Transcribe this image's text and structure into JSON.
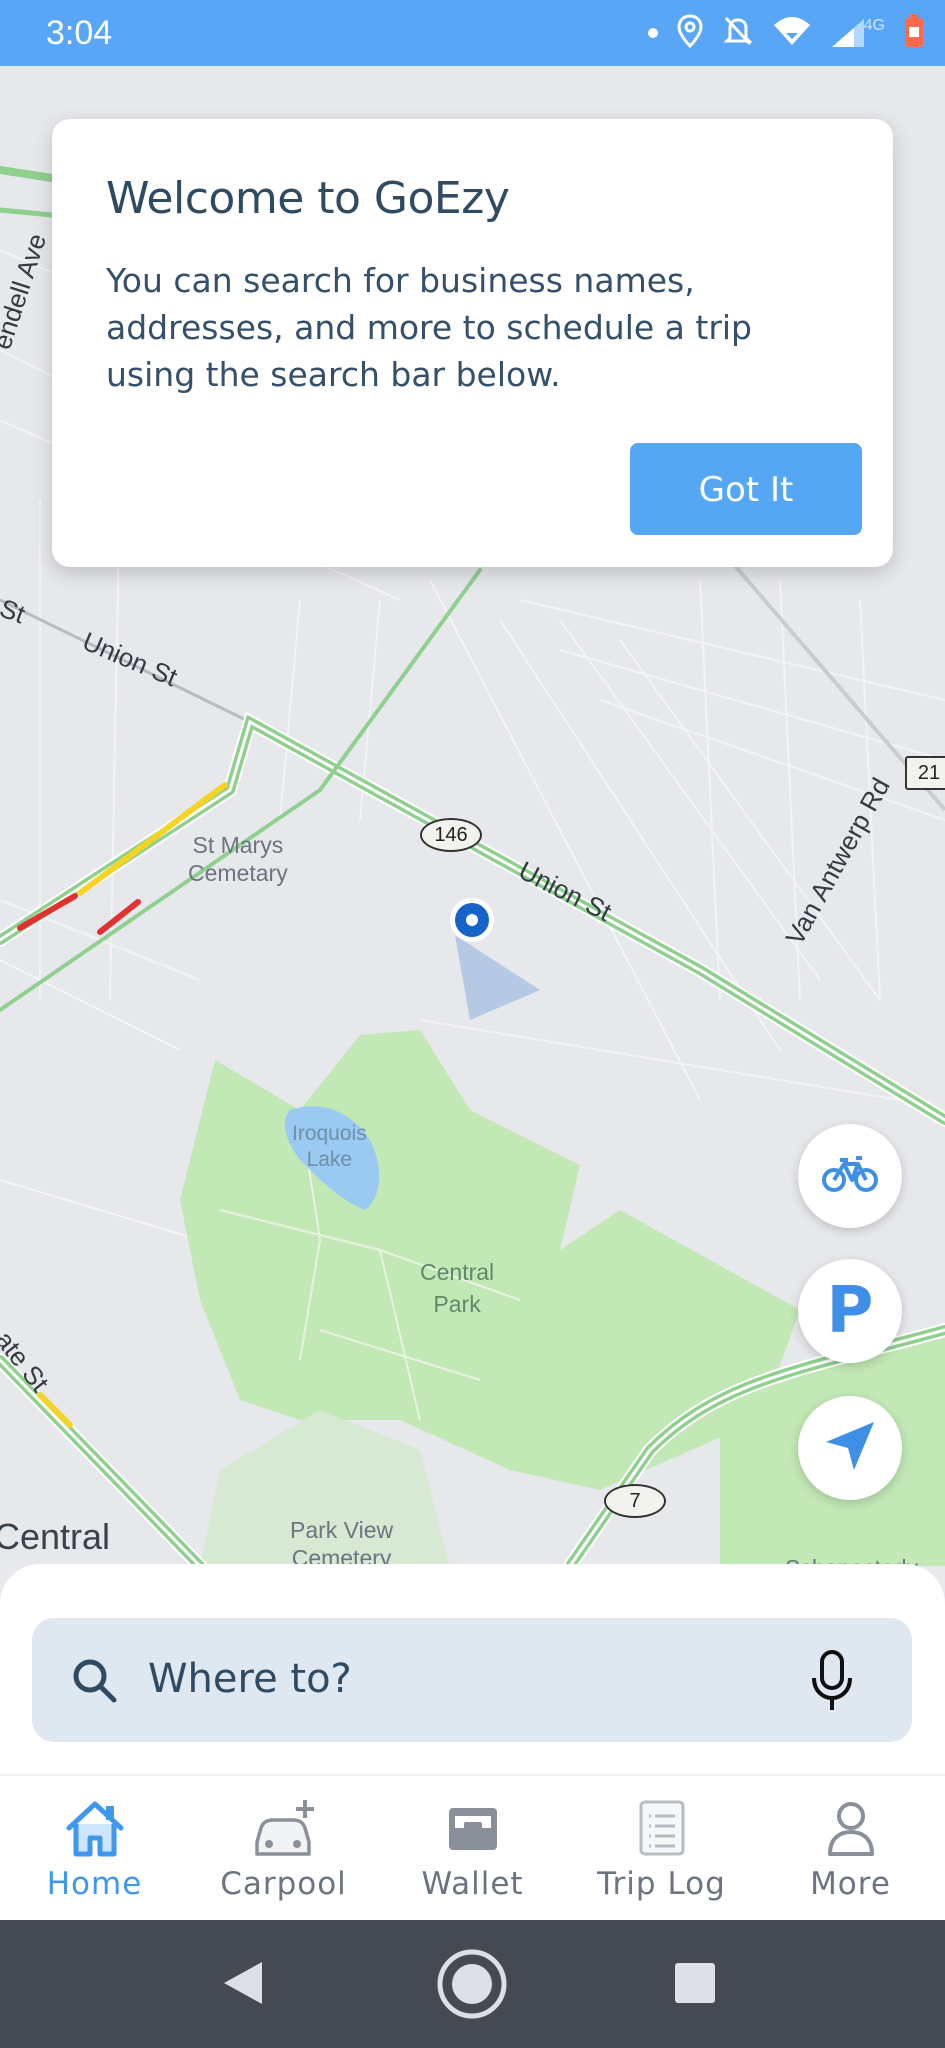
{
  "status_bar": {
    "time": "3:04",
    "network": "4G",
    "icons": [
      "dot-icon",
      "location-pin-icon",
      "bell-off-icon",
      "wifi-icon",
      "signal-icon",
      "battery-icon"
    ]
  },
  "map": {
    "roads": {
      "union_st_top": "Union St",
      "union_st_main": "Union St",
      "van_antwerp": "Van Antwerp Rd",
      "state_st": "ate St",
      "st_left": "St",
      "kendell": "endell Ave"
    },
    "shields": {
      "route_146": "146",
      "route_7": "7",
      "route_21": "21"
    },
    "places": {
      "st_marys": [
        "St Marys",
        "Cemetary"
      ],
      "iroquois": [
        "Iroquois",
        "Lake"
      ],
      "central_park": [
        "Central",
        "Park"
      ],
      "park_view": [
        "Park View",
        "Cemetery"
      ],
      "central_left": "Central",
      "schenectady": "Schenectady"
    },
    "colors": {
      "park": "#c2e8b5",
      "water": "#9ac9f2",
      "route": "#8fd08f",
      "traffic_yellow": "#f5d327",
      "traffic_red": "#e0322f",
      "user_dot": "#1664c8"
    }
  },
  "welcome_card": {
    "title": "Welcome to GoEzy",
    "body": "You can search for business names, addresses, and more to schedule a trip using the search bar below.",
    "button": "Got It"
  },
  "fabs": [
    "bike-icon",
    "parking-icon",
    "navigation-arrow-icon"
  ],
  "fab_labels": {
    "parking": "P"
  },
  "search": {
    "placeholder": "Where to?"
  },
  "bottom_nav": {
    "items": [
      {
        "label": "Home",
        "icon": "home-icon",
        "active": true
      },
      {
        "label": "Carpool",
        "icon": "car-add-icon",
        "active": false
      },
      {
        "label": "Wallet",
        "icon": "wallet-icon",
        "active": false
      },
      {
        "label": "Trip Log",
        "icon": "trip-log-icon",
        "active": false
      },
      {
        "label": "More",
        "icon": "person-icon",
        "active": false
      }
    ]
  },
  "theme": {
    "accent": "#55a6f3",
    "status_bar": "#58a6f5",
    "text_dark": "#2e4b63"
  }
}
